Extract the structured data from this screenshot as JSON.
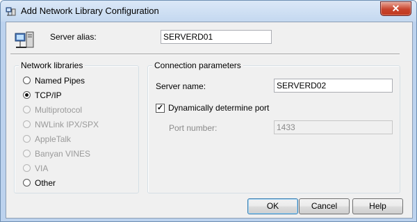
{
  "window": {
    "title": "Add Network Library Configuration",
    "close_label": "✕"
  },
  "alias": {
    "label": "Server alias:",
    "value": "SERVERD01"
  },
  "network_libraries": {
    "title": "Network libraries",
    "options": [
      {
        "label": "Named Pipes",
        "selected": false,
        "enabled": true
      },
      {
        "label": "TCP/IP",
        "selected": true,
        "enabled": true
      },
      {
        "label": "Multiprotocol",
        "selected": false,
        "enabled": false
      },
      {
        "label": "NWLink IPX/SPX",
        "selected": false,
        "enabled": false
      },
      {
        "label": "AppleTalk",
        "selected": false,
        "enabled": false
      },
      {
        "label": "Banyan VINES",
        "selected": false,
        "enabled": false
      },
      {
        "label": "VIA",
        "selected": false,
        "enabled": false
      },
      {
        "label": "Other",
        "selected": false,
        "enabled": true
      }
    ]
  },
  "connection": {
    "title": "Connection parameters",
    "server_name_label": "Server name:",
    "server_name_value": "SERVERD02",
    "dynamic_label": "Dynamically determine port",
    "dynamic_checked": true,
    "port_label": "Port number:",
    "port_value": "1433"
  },
  "buttons": {
    "ok": "OK",
    "cancel": "Cancel",
    "help": "Help"
  },
  "icons": {
    "title_icon": "network-config-icon",
    "alias_icon": "server-network-icon"
  }
}
